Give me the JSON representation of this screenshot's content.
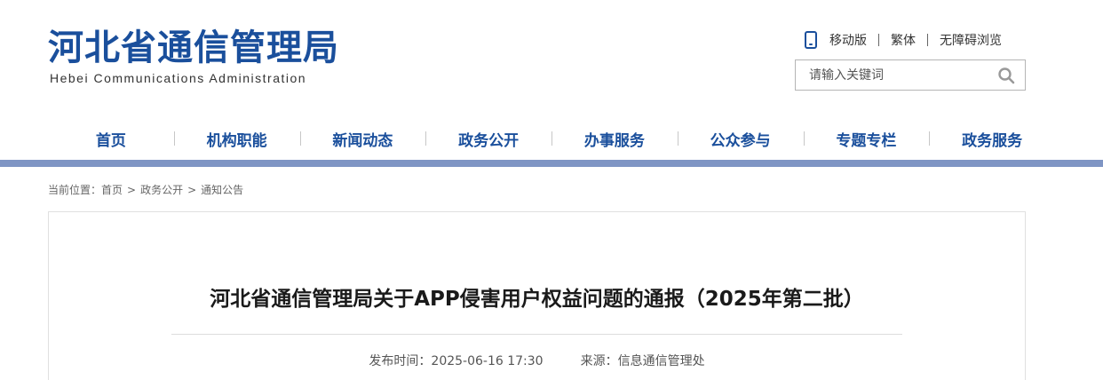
{
  "header": {
    "logo_cn": "河北省通信管理局",
    "logo_en": "Hebei Communications Administration",
    "links": [
      "移动版",
      "繁体",
      "无障碍浏览"
    ],
    "search_placeholder": "请输入关键词"
  },
  "nav": {
    "items": [
      "首页",
      "机构职能",
      "新闻动态",
      "政务公开",
      "办事服务",
      "公众参与",
      "专题专栏",
      "政务服务"
    ]
  },
  "breadcrumb": {
    "label": "当前位置：",
    "items": [
      "首页",
      "政务公开",
      "通知公告"
    ],
    "separator": ">"
  },
  "article": {
    "title": "河北省通信管理局关于APP侵害用户权益问题的通报（2025年第二批）",
    "publish_time": "发布时间：2025-06-16 17:30",
    "source": "来源：信息通信管理处"
  },
  "colors": {
    "brand": "#1a4f9c",
    "nav_bar": "#7f95c4"
  },
  "icons": {
    "mobile": "mobile-phone-icon",
    "search": "search-icon"
  }
}
